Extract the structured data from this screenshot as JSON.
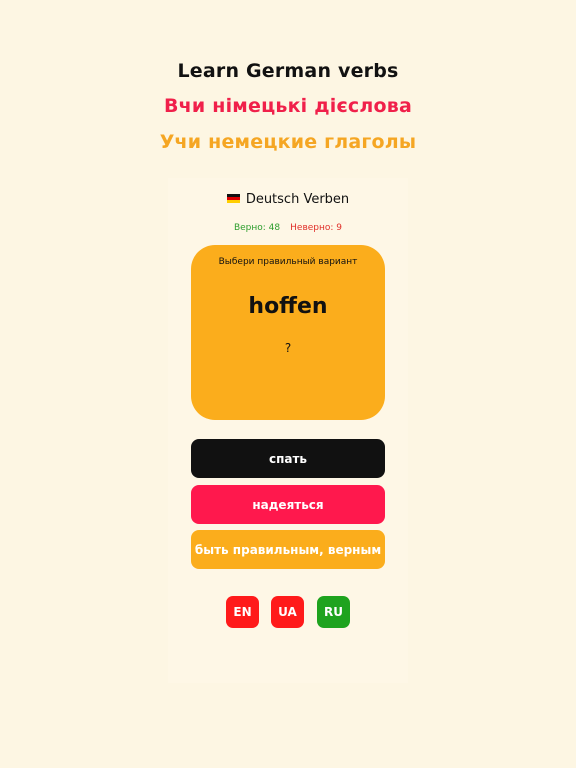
{
  "headlines": {
    "en": "Learn German verbs",
    "ua": "Вчи німецькі дієслова",
    "ru": "Учи немецкие глаголы"
  },
  "colors": {
    "background": "#fdf6e3",
    "accent_orange": "#fbad1c",
    "accent_pink": "#ff184d",
    "dark": "#111111",
    "lang_red": "#ff1a1a",
    "lang_green": "#1ea31e",
    "correct_green": "#2e9e2e",
    "wrong_red": "#e0302a"
  },
  "app": {
    "flag_icon": "german-flag-icon",
    "title": "Deutsch Verben"
  },
  "score": {
    "correct": "Верно: 48",
    "wrong": "Неверно: 9"
  },
  "card": {
    "hint": "Выбери правильный вариант",
    "word": "hoffen",
    "question_mark": "?"
  },
  "answers": [
    {
      "label": "спать"
    },
    {
      "label": "надеяться"
    },
    {
      "label": "быть правильным, верным"
    }
  ],
  "languages": [
    {
      "label": "EN"
    },
    {
      "label": "UA"
    },
    {
      "label": "RU"
    }
  ]
}
